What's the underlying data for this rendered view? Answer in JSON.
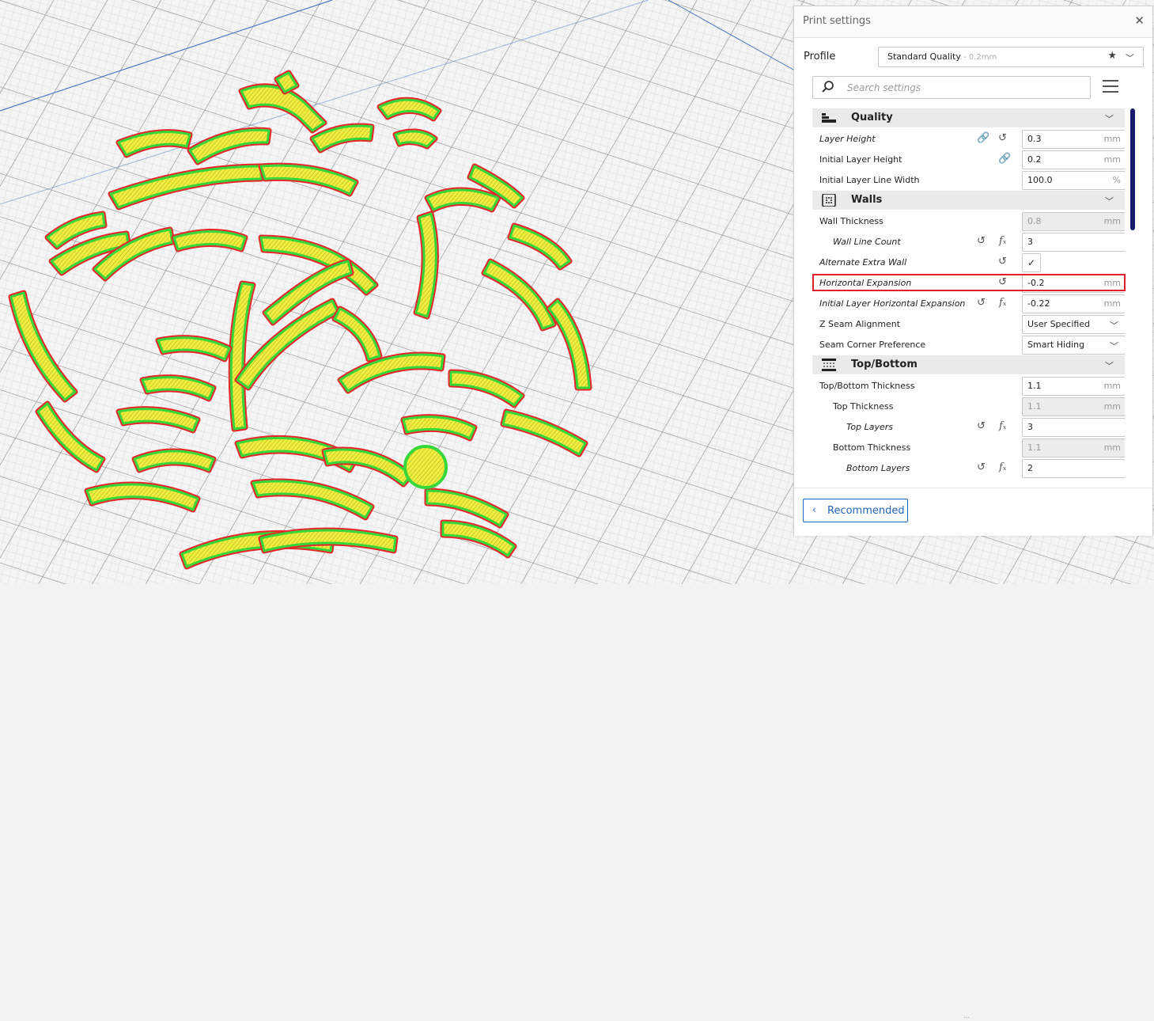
{
  "panel": {
    "title": "Print settings",
    "profile_label": "Profile",
    "profile_name": "Standard Quality",
    "profile_sub": " - 0.2mm",
    "search_placeholder": "Search settings",
    "recommended_label": "Recommended",
    "icons": {
      "close": "close-icon",
      "star": "star-icon",
      "search": "search-icon",
      "menu": "menu-icon",
      "chevron": "chevron-down-icon",
      "reset": "reset-icon",
      "link": "link-icon",
      "function": "function-icon"
    }
  },
  "categories": {
    "quality": "Quality",
    "walls": "Walls",
    "topbottom": "Top/Bottom"
  },
  "settings": {
    "layer_height": {
      "label": "Layer Height",
      "value": "0.3",
      "unit": "mm"
    },
    "initial_layer_height": {
      "label": "Initial Layer Height",
      "value": "0.2",
      "unit": "mm"
    },
    "initial_layer_line_width": {
      "label": "Initial Layer Line Width",
      "value": "100.0",
      "unit": "%"
    },
    "wall_thickness": {
      "label": "Wall Thickness",
      "value": "0.8",
      "unit": "mm"
    },
    "wall_line_count": {
      "label": "Wall Line Count",
      "value": "3"
    },
    "alternate_extra_wall": {
      "label": "Alternate Extra Wall",
      "checked": true
    },
    "horizontal_expansion": {
      "label": "Horizontal Expansion",
      "value": "-0.2",
      "unit": "mm"
    },
    "initial_layer_horizontal_expansion": {
      "label": "Initial Layer Horizontal Expansion",
      "value": "-0.22",
      "unit": "mm"
    },
    "z_seam_alignment": {
      "label": "Z Seam Alignment",
      "value": "User Specified"
    },
    "seam_corner_preference": {
      "label": "Seam Corner Preference",
      "value": "Smart Hiding"
    },
    "top_bottom_thickness": {
      "label": "Top/Bottom Thickness",
      "value": "1.1",
      "unit": "mm"
    },
    "top_thickness": {
      "label": "Top Thickness",
      "value": "1.1",
      "unit": "mm"
    },
    "top_layers": {
      "label": "Top Layers",
      "value": "3"
    },
    "bottom_thickness": {
      "label": "Bottom Thickness",
      "value": "1.1",
      "unit": "mm"
    },
    "bottom_layers": {
      "label": "Bottom Layers",
      "value": "2"
    }
  },
  "colors": {
    "highlight": "#e0202a",
    "accent": "#1f62b9",
    "wall_outer": "#e8262b",
    "wall_inner": "#37d63a",
    "infill": "#f0ee3c",
    "grid_line": "#8f8f8f"
  }
}
